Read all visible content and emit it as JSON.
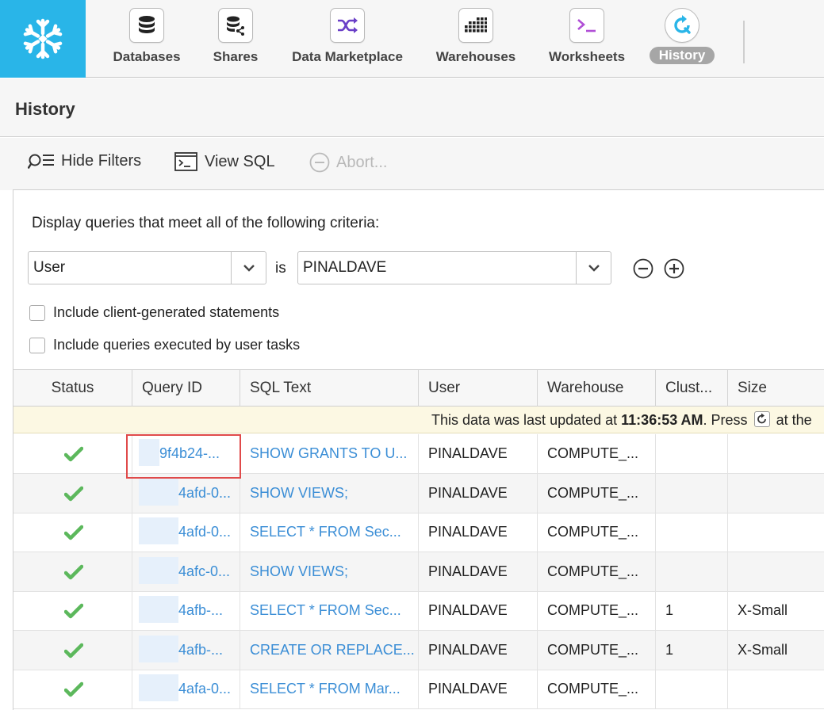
{
  "nav": {
    "items": [
      {
        "label": "Databases",
        "icon": "database-icon"
      },
      {
        "label": "Shares",
        "icon": "shares-icon"
      },
      {
        "label": "Data Marketplace",
        "icon": "shuffle-icon"
      },
      {
        "label": "Warehouses",
        "icon": "warehouse-grid-icon"
      },
      {
        "label": "Worksheets",
        "icon": "terminal-icon"
      },
      {
        "label": "History",
        "icon": "history-icon",
        "active": true
      }
    ]
  },
  "page": {
    "title": "History"
  },
  "toolbar": {
    "hide_filters": "Hide Filters",
    "view_sql": "View SQL",
    "abort": "Abort..."
  },
  "filters": {
    "criteria_text": "Display queries that meet all of the following criteria:",
    "field": "User",
    "operator": "is",
    "value": "PINALDAVE",
    "client_generated": "Include client-generated statements",
    "user_tasks": "Include queries executed by user tasks"
  },
  "table": {
    "columns": [
      "Status",
      "Query ID",
      "SQL Text",
      "User",
      "Warehouse",
      "Clust...",
      "Size"
    ],
    "notice": {
      "prefix": "This data was last updated at ",
      "time": "11:36:53 AM",
      "suffix": ". Press ",
      "tail": " at the"
    },
    "rows": [
      {
        "query_id": "9f4b24-...",
        "sql": "SHOW GRANTS TO U...",
        "user": "PINALDAVE",
        "warehouse": "COMPUTE_...",
        "cluster": "",
        "size": ""
      },
      {
        "query_id": "4afd-0...",
        "sql": "SHOW VIEWS;",
        "user": "PINALDAVE",
        "warehouse": "COMPUTE_...",
        "cluster": "",
        "size": ""
      },
      {
        "query_id": "4afd-0...",
        "sql": "SELECT * FROM Sec...",
        "user": "PINALDAVE",
        "warehouse": "COMPUTE_...",
        "cluster": "",
        "size": ""
      },
      {
        "query_id": "4afc-0...",
        "sql": "SHOW VIEWS;",
        "user": "PINALDAVE",
        "warehouse": "COMPUTE_...",
        "cluster": "",
        "size": ""
      },
      {
        "query_id": "4afb-...",
        "sql": "SELECT * FROM Sec...",
        "user": "PINALDAVE",
        "warehouse": "COMPUTE_...",
        "cluster": "1",
        "size": "X-Small"
      },
      {
        "query_id": "4afb-...",
        "sql": "CREATE OR REPLACE...",
        "user": "PINALDAVE",
        "warehouse": "COMPUTE_...",
        "cluster": "1",
        "size": "X-Small"
      },
      {
        "query_id": "4afa-0...",
        "sql": "SELECT * FROM Mar...",
        "user": "PINALDAVE",
        "warehouse": "COMPUTE_...",
        "cluster": "",
        "size": ""
      }
    ]
  },
  "colors": {
    "brand": "#29b5e8",
    "link": "#3b8ed6",
    "success": "#5cb85c",
    "highlight": "#e04a4a"
  }
}
